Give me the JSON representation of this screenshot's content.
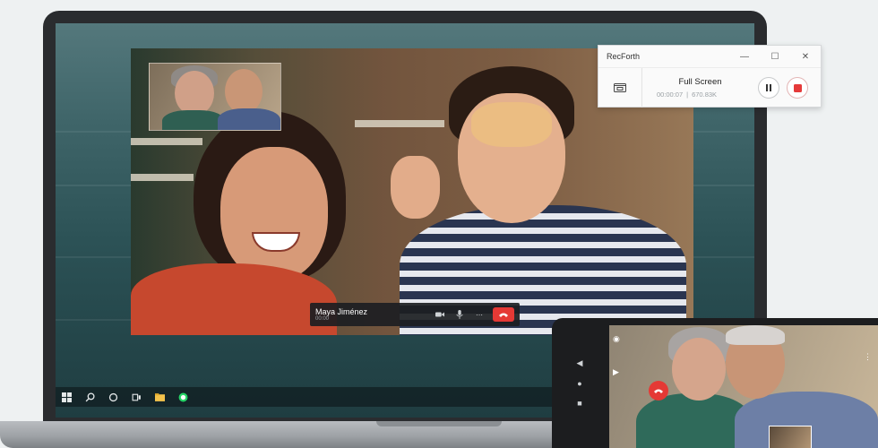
{
  "recorder": {
    "title": "RecForth",
    "mode": "Full Screen",
    "elapsed": "00:00:07",
    "size": "670.83K",
    "controls": {
      "minimize": "—",
      "maximize": "☐",
      "close": "✕"
    },
    "icons": {
      "device": "screen-record-icon",
      "pause": "pause-icon",
      "stop": "stop-icon"
    }
  },
  "call": {
    "caller_name": "Maya Jiménez",
    "caller_sub": "00:00",
    "icons": [
      "video-icon",
      "mic-icon",
      "more-icon",
      "end-call-icon"
    ],
    "end_color": "#e53935"
  },
  "taskbar": {
    "icons": [
      "windows-icon",
      "search-icon",
      "cortana-icon",
      "task-view-icon",
      "file-explorer-icon",
      "whatsapp-icon"
    ]
  },
  "phone": {
    "icons": [
      "camera-icon",
      "video-icon",
      "end-call-icon",
      "more-icon"
    ]
  }
}
